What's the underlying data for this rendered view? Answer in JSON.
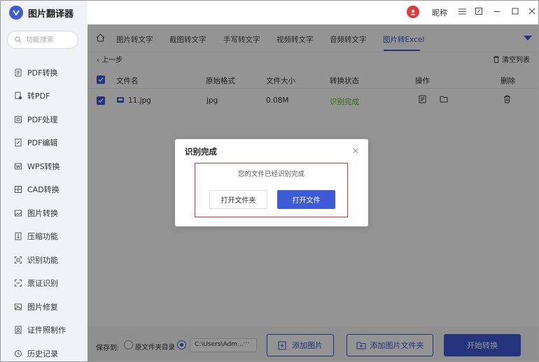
{
  "app": {
    "title": "图片翻译器"
  },
  "search": {
    "placeholder": "功能搜索"
  },
  "sidebar": {
    "items": [
      {
        "label": "PDF转换",
        "icon": "pdf-convert-icon"
      },
      {
        "label": "转PDF",
        "icon": "to-pdf-icon"
      },
      {
        "label": "PDF处理",
        "icon": "pdf-process-icon"
      },
      {
        "label": "PDF编辑",
        "icon": "pdf-edit-icon"
      },
      {
        "label": "WPS转换",
        "icon": "wps-icon"
      },
      {
        "label": "CAD转换",
        "icon": "cad-icon"
      },
      {
        "label": "图片转换",
        "icon": "image-convert-icon"
      },
      {
        "label": "压缩功能",
        "icon": "compress-icon"
      },
      {
        "label": "识别功能",
        "icon": "scan-icon"
      },
      {
        "label": "票证识别",
        "icon": "ticket-icon"
      },
      {
        "label": "图片修复",
        "icon": "image-repair-icon"
      },
      {
        "label": "证件照制作",
        "icon": "id-photo-icon"
      },
      {
        "label": "历史记录",
        "icon": "history-icon"
      }
    ]
  },
  "user": {
    "nickname": "昵称"
  },
  "tabs": [
    {
      "label": "图片转文字"
    },
    {
      "label": "截图转文字"
    },
    {
      "label": "手写转文字"
    },
    {
      "label": "视频转文字"
    },
    {
      "label": "音频转文字"
    },
    {
      "label": "图片转Excel"
    }
  ],
  "toolbar": {
    "back_label": "上一步",
    "clear_label": "清空列表"
  },
  "table": {
    "headers": {
      "filename": "文件名",
      "format": "原始格式",
      "size": "文件大小",
      "status": "转换状态",
      "actions": "操作",
      "delete": "删除"
    },
    "rows": [
      {
        "filename": "11.jpg",
        "format": "jpg",
        "size": "0.08M",
        "status": "识别完成"
      }
    ]
  },
  "savebar": {
    "save_label": "保存到:",
    "source_dir_label": "原文件夹目录",
    "path": "C:\\Users\\Adm...",
    "path_more": "···",
    "add_image_label": "添加图片",
    "add_folder_label": "添加图片文件夹",
    "start_label": "开始转换"
  },
  "dialog": {
    "title": "识别完成",
    "message": "您的文件已经识别完成",
    "open_folder_label": "打开文件夹",
    "open_file_label": "打开文件"
  },
  "colors": {
    "accent": "#3d5bd6",
    "success": "#52c41a",
    "highlight": "#e03434"
  }
}
